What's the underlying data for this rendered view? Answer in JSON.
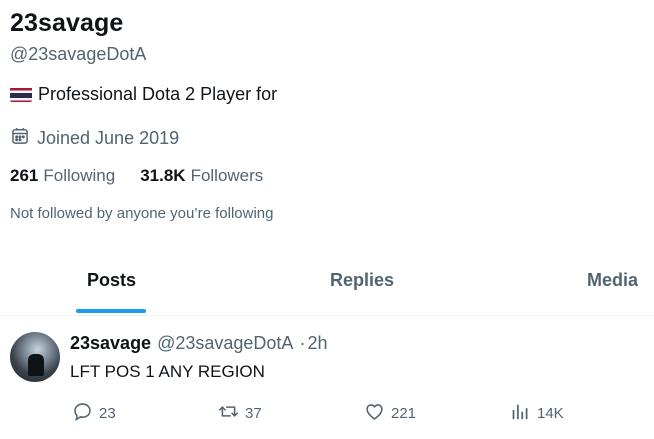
{
  "profile": {
    "display_name": "23savage",
    "handle": "@23savageDotA",
    "bio": "Professional Dota 2 Player for",
    "joined": "Joined June 2019",
    "following_count": "261",
    "following_label": "Following",
    "followers_count": "31.8K",
    "followers_label": "Followers",
    "not_followed_text": "Not followed by anyone you’re following"
  },
  "tabs": [
    {
      "label": "Posts",
      "active": true
    },
    {
      "label": "Replies",
      "active": false
    },
    {
      "label": "Media",
      "active": false
    }
  ],
  "tweet": {
    "author_name": "23savage",
    "author_handle": "@23savageDotA",
    "separator": "·",
    "time": "2h",
    "text": "LFT POS 1 ANY REGION",
    "replies": "23",
    "reposts": "37",
    "likes": "221",
    "views": "14K"
  },
  "icons": {
    "flag": "thailand-flag-icon",
    "calendar": "calendar-icon",
    "reply": "reply-icon",
    "repost": "repost-icon",
    "like": "heart-icon",
    "views": "views-icon"
  },
  "colors": {
    "accent": "#1d9bf0",
    "secondary_text": "#536471",
    "primary_text": "#0f1419"
  }
}
